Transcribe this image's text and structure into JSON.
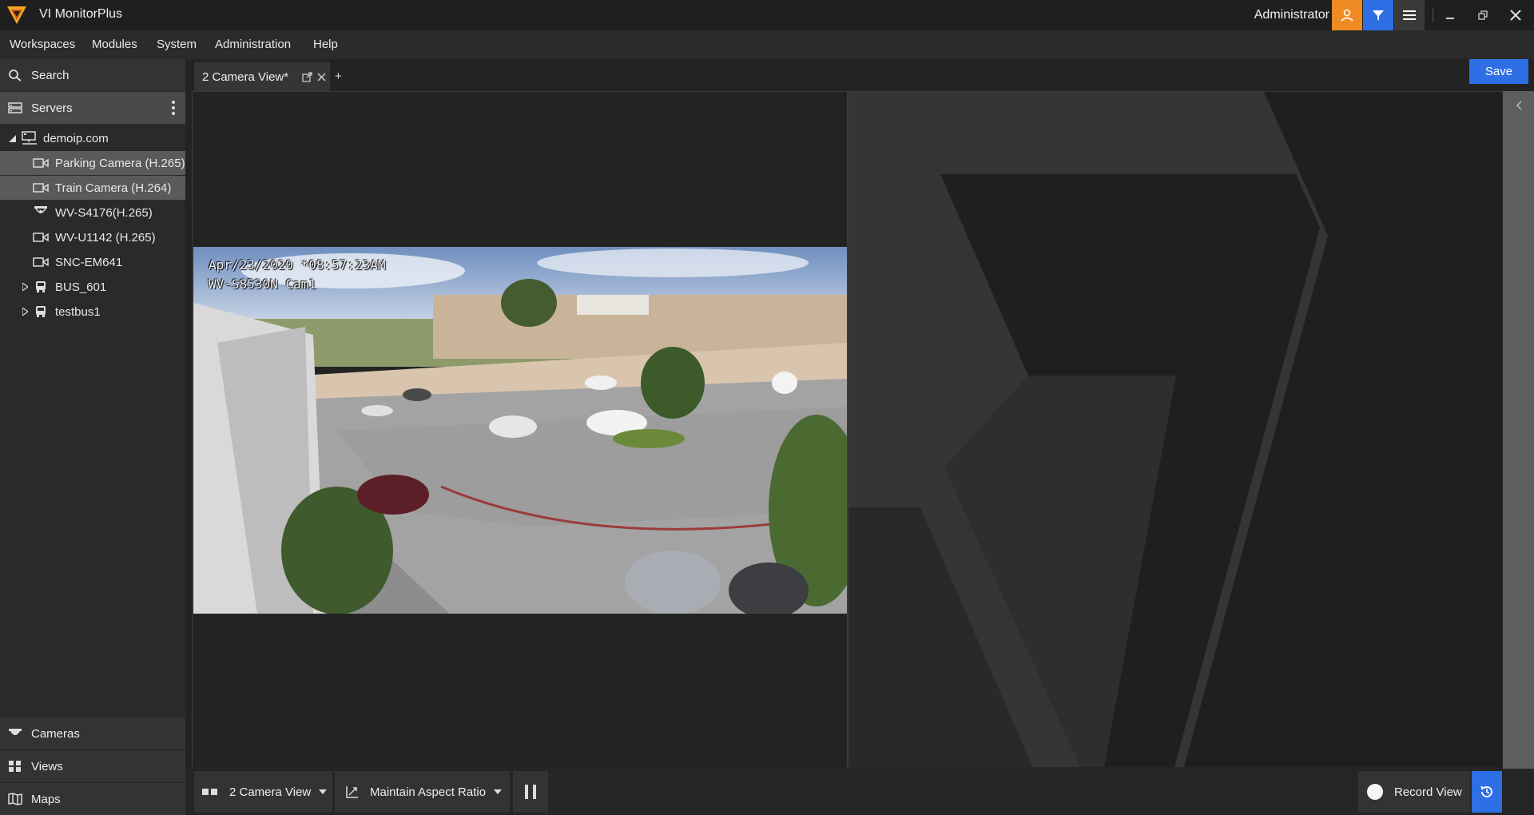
{
  "app": {
    "title": "VI MonitorPlus",
    "user": "Administrator"
  },
  "menu": {
    "items": [
      "Workspaces",
      "Modules",
      "System",
      "Administration",
      "Help"
    ]
  },
  "sidebar": {
    "search_label": "Search",
    "servers_label": "Servers",
    "tree": {
      "root": "demoip.com",
      "items": [
        {
          "label": "Parking Camera (H.265)",
          "icon": "camera-icon",
          "state": "selected"
        },
        {
          "label": "Train Camera (H.264)",
          "icon": "camera-icon",
          "state": "selected"
        },
        {
          "label": "WV-S4176(H.265)",
          "icon": "dome-360-camera-icon",
          "state": "normal"
        },
        {
          "label": "WV-U1142 (H.265)",
          "icon": "camera-icon",
          "state": "normal"
        },
        {
          "label": "SNC-EM641",
          "icon": "camera-icon",
          "state": "normal"
        },
        {
          "label": "BUS_601",
          "icon": "bus-icon",
          "state": "collapsed"
        },
        {
          "label": "testbus1",
          "icon": "bus-icon",
          "state": "collapsed"
        }
      ]
    },
    "bottom": {
      "cameras": "Cameras",
      "views": "Views",
      "maps": "Maps"
    }
  },
  "tabs": {
    "active": "2 Camera View*",
    "add": "+"
  },
  "save_label": "Save",
  "camera": {
    "timestamp": "Apr/23/2020 *08:57:23AM",
    "name": "WV-S8530N Cam1"
  },
  "toolbar": {
    "layout_label": "2 Camera View",
    "aspect_label": "Maintain Aspect Ratio",
    "record_label": "Record View"
  },
  "colors": {
    "accent_orange": "#f08a24",
    "accent_blue": "#2f6fe6",
    "background": "#232323"
  }
}
